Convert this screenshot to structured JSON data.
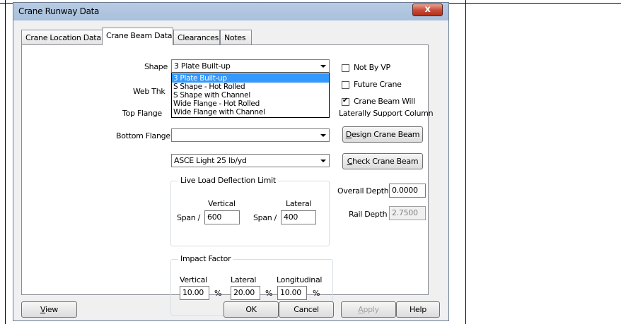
{
  "window": {
    "title": "Crane Runway Data",
    "close_glyph": "x"
  },
  "tabs": [
    {
      "label": "Crane Location Data",
      "active": false
    },
    {
      "label": "Crane Beam Data",
      "active": true
    },
    {
      "label": "Clearances",
      "active": false
    },
    {
      "label": "Notes",
      "active": false
    }
  ],
  "form": {
    "shape_label": "Shape",
    "shape_value": "3 Plate Built-up",
    "shape_options": [
      "3 Plate Built-up",
      "S Shape - Hot Rolled",
      "S Shape with Channel",
      "Wide Flange - Hot Rolled",
      "Wide Flange with Channel"
    ],
    "web_thk_label": "Web Thk",
    "top_flange_label": "Top Flange",
    "bottom_flange_label": "Bottom Flange",
    "bottom_flange_value": "",
    "rail_value": "ASCE Light 25 lb/yd"
  },
  "checkboxes": {
    "not_by_vp": {
      "label": "Not By VP",
      "checked": false
    },
    "future_crane": {
      "label": "Future Crane",
      "checked": false
    },
    "laterally_support": {
      "label_line1": "Crane Beam Will",
      "label_line2": "Laterally Support Column",
      "checked": true
    }
  },
  "deflection": {
    "title": "Live Load Deflection Limit",
    "vertical_label": "Vertical",
    "lateral_label": "Lateral",
    "span_label_1": "Span /",
    "span_label_2": "Span /",
    "vertical_value": "600",
    "lateral_value": "400"
  },
  "impact": {
    "title": "Impact Factor",
    "vertical_label": "Vertical",
    "lateral_label": "Lateral",
    "longitudinal_label": "Longitudinal",
    "vertical_value": "10.00",
    "lateral_value": "20.00",
    "longitudinal_value": "10.00",
    "pct": "%"
  },
  "buttons": {
    "design_crane_beam_u": "D",
    "design_crane_beam_rest": "esign Crane Beam",
    "check_crane_beam_u": "C",
    "check_crane_beam_rest": "heck Crane Beam",
    "view_u": "V",
    "view_rest": "iew",
    "ok": "OK",
    "cancel": "Cancel",
    "apply_u": "A",
    "apply_rest": "pply",
    "help": "Help"
  },
  "depths": {
    "overall_label": "Overall Depth",
    "overall_value": "0.0000",
    "rail_label": "Rail Depth",
    "rail_value": "2.7500"
  }
}
